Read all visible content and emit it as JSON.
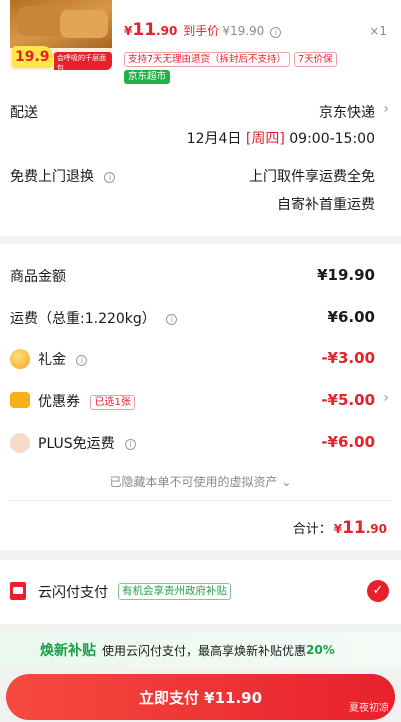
{
  "product": {
    "thumb_price": "19.9",
    "thumb_tagline": "会呼吸的千层面包",
    "price_symbol": "¥",
    "price_int": "11",
    "price_dec": ".90",
    "hand_price_label": "到手价",
    "hand_price_value": "¥19.90",
    "quantity": "×1",
    "service_tags": [
      "支持7天无理由退货（拆封后不支持）",
      "7天价保"
    ],
    "store_badge": "京东超市"
  },
  "delivery": {
    "label": "配送",
    "carrier": "京东快递",
    "date_prefix": "12月4日",
    "weekday": "[周四]",
    "time_window": "09:00-15:00"
  },
  "returns": {
    "label": "免费上门退换",
    "line1": "上门取件享运费全免",
    "line2": "自寄补首重运费"
  },
  "totals": {
    "goods_label": "商品金额",
    "goods_value": "¥19.90",
    "shipping_label": "运费（总重:1.220kg）",
    "shipping_value": "¥6.00",
    "gift_label": "礼金",
    "gift_value": "-¥3.00",
    "coupon_label": "优惠券",
    "coupon_badge": "已选1张",
    "coupon_value": "-¥5.00",
    "plus_label": "PLUS免运费",
    "plus_value": "-¥6.00",
    "hidden_assets": "已隐藏本单不可使用的虚拟资产",
    "total_label": "合计：",
    "total_symbol": "¥",
    "total_int": "11",
    "total_dec": ".90"
  },
  "payment": {
    "method": "云闪付支付",
    "promo": "有机会享贵州政府补贴"
  },
  "subsidy": {
    "title": "焕新补贴",
    "desc": "使用云闪付支付，最高享焕新补贴优惠",
    "pct": "20%"
  },
  "pay_button": "立即支付 ¥11.90",
  "watermark": "夏夜初凉",
  "colors": {
    "accent": "#e8202c",
    "green": "#1aa045"
  }
}
